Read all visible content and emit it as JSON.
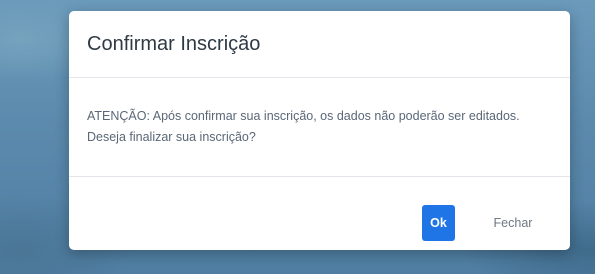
{
  "dialog": {
    "title": "Confirmar Inscrição",
    "message": "ATENÇÃO: Após confirmar sua inscrição, os dados não poderão ser editados. Deseja finalizar sua inscrição?",
    "ok_label": "Ok",
    "close_label": "Fechar"
  },
  "colors": {
    "primary_button": "#1f74e6",
    "backdrop": "#5f8fb0"
  }
}
